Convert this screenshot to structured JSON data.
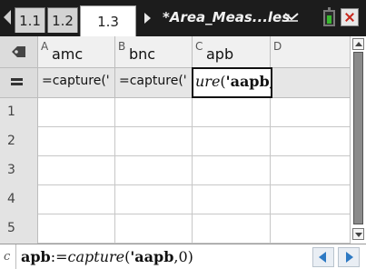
{
  "tabs": [
    {
      "label": "1.1",
      "active": false
    },
    {
      "label": "1.2",
      "active": false
    },
    {
      "label": "1.3",
      "active": true
    }
  ],
  "document_title": "*Area_Meas...les",
  "columns": [
    {
      "letter": "A",
      "name": "amc",
      "formula": "=capture('"
    },
    {
      "letter": "B",
      "name": "bnc",
      "formula": "=capture('"
    },
    {
      "letter": "C",
      "name": "apb",
      "formula_prefix": "ure",
      "formula_paren": "(",
      "formula_arg": "'aapb,",
      "formula_rest": "(",
      "selected": true
    },
    {
      "letter": "D",
      "name": "",
      "formula": ""
    }
  ],
  "rows": [
    "1",
    "2",
    "3",
    "4",
    "5"
  ],
  "entry_line": {
    "cell_label": "c",
    "variable": "apb",
    "assign": ":=",
    "function": "capture",
    "open_paren": "(",
    "argument": "'aapb",
    "rest": ",0)"
  },
  "icons": {
    "tab_left": "tab-scroll-left-icon",
    "tab_right": "tab-scroll-right-icon",
    "document_menu": "chevron-down-icon",
    "battery": "battery-icon",
    "close": "close-icon",
    "pin": "pin-icon",
    "formula": "equals-icon",
    "nav_prev": "arrow-left-icon",
    "nav_next": "arrow-right-icon"
  },
  "colors": {
    "tab_bar": "#1c1c1c",
    "nav_button": "#2d79c3",
    "battery": "#38b82f",
    "close": "#c8281e"
  }
}
